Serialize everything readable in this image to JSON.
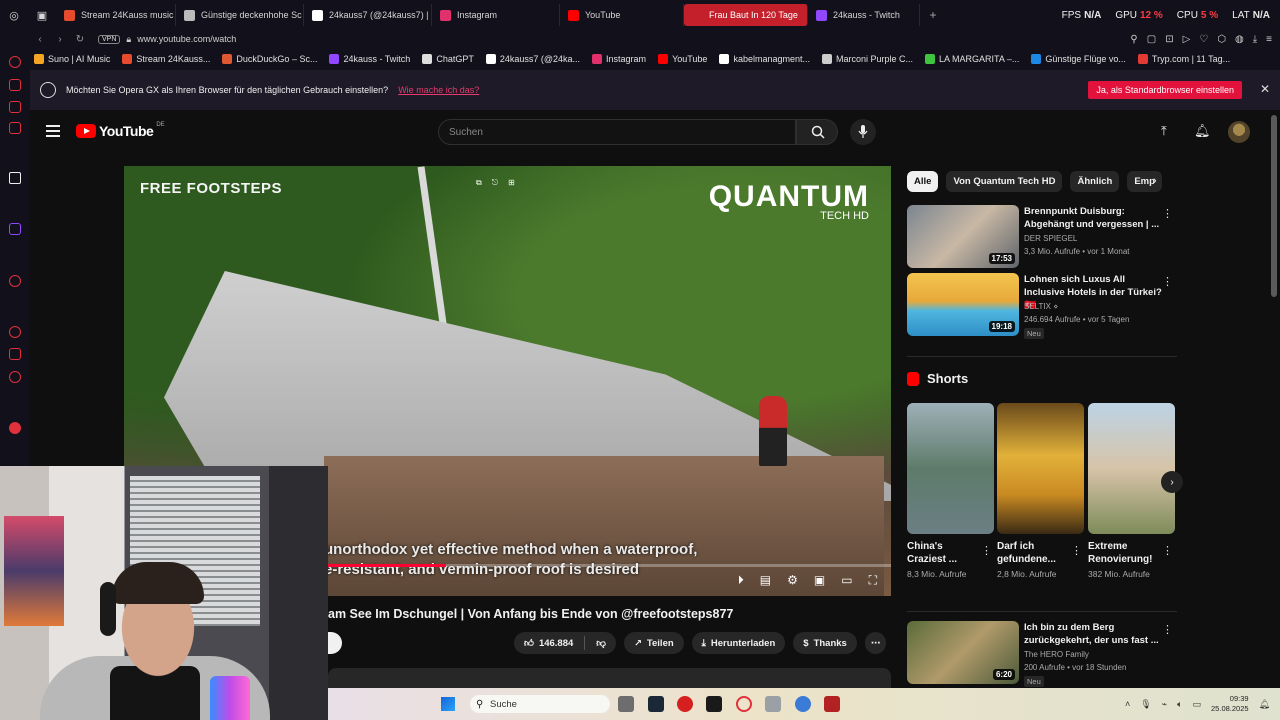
{
  "browser": {
    "tabs": [
      {
        "label": "Stream 24Kauss music | L",
        "color": "#e54b2c"
      },
      {
        "label": "Günstige deckenhohe Sc",
        "color": "#bbbbbb"
      },
      {
        "label": "24kauss7 (@24kauss7) |",
        "color": "#ffffff"
      },
      {
        "label": "Instagram",
        "color": "#e1306c"
      },
      {
        "label": "YouTube",
        "color": "#ff0000"
      },
      {
        "label": "Frau Baut In 120 Tage",
        "color": "#ffffff",
        "active": true
      },
      {
        "label": "24kauss - Twitch",
        "color": "#9146ff"
      }
    ],
    "sys": {
      "fps_label": "FPS",
      "fps_value": "N/A",
      "gpu_label": "GPU",
      "gpu_value": "12 %",
      "cpu_label": "CPU",
      "cpu_value": "5 %",
      "lat_label": "LAT",
      "lat_value": "N/A"
    },
    "vpn": "VPN",
    "url": "www.youtube.com/watch",
    "bookmarks": [
      {
        "label": "Suno | AI Music",
        "color": "#f5a524"
      },
      {
        "label": "Stream 24Kauss...",
        "color": "#e54b2c"
      },
      {
        "label": "DuckDuckGo – Sc...",
        "color": "#de5833"
      },
      {
        "label": "24kauss - Twitch",
        "color": "#9146ff"
      },
      {
        "label": "ChatGPT",
        "color": "#dddddd"
      },
      {
        "label": "24kauss7 (@24ka...",
        "color": "#ffffff"
      },
      {
        "label": "Instagram",
        "color": "#e1306c"
      },
      {
        "label": "YouTube",
        "color": "#ff0000"
      },
      {
        "label": "kabelmanagment...",
        "color": "#ffffff"
      },
      {
        "label": "Marconi Purple C...",
        "color": "#cccccc"
      },
      {
        "label": "LA MARGARITA –...",
        "color": "#3ec43e"
      },
      {
        "label": "Günstige Flüge vo...",
        "color": "#1e88e5"
      },
      {
        "label": "Tryp.com | 11 Tag...",
        "color": "#e53935"
      }
    ]
  },
  "infobar": {
    "text": "Möchten Sie Opera GX als Ihren Browser für den täglichen Gebrauch einstellen?",
    "link": "Wie mache ich das?",
    "button": "Ja, als Standardbrowser einstellen",
    "close": "✕"
  },
  "youtube": {
    "logo": "YouTube",
    "region": "DE",
    "search_placeholder": "Suchen",
    "player": {
      "watermark_left": "FREE FOOTSTEPS",
      "watermark_brand": "QUANTUM",
      "watermark_brand_sub": "TECH HD",
      "subtitle_line1": "unorthodox yet effective method when a waterproof,",
      "subtitle_line2": "e-resistant, and vermin-proof roof is desired",
      "progress": 0.42
    },
    "video_title": "am See Im Dschungel | Von Anfang bis Ende von @freefootsteps877",
    "actions": {
      "likes": "146.884",
      "share": "Teilen",
      "download": "Herunterladen",
      "thanks": "Thanks"
    },
    "chips": [
      "Alle",
      "Von Quantum Tech HD",
      "Ähnlich",
      "Emp"
    ],
    "recommendations": [
      {
        "title": "Brennpunkt Duisburg: Abgehängt und vergessen | ...",
        "channel": "DER SPIEGEL",
        "meta": "3,3 Mio. Aufrufe • vor 1 Monat",
        "duration": "17:53",
        "badge": ""
      },
      {
        "title": "Lohnen sich Luxus All Inclusive Hotels in der Türkei? 🇹🇷",
        "channel": "SELTIX ⋄",
        "meta": "246.694 Aufrufe • vor 5 Tagen",
        "duration": "19:18",
        "badge": "Neu"
      },
      {
        "title": "Ich bin zu dem Berg zurückgekehrt, der uns fast ...",
        "channel": "The HERO Family",
        "meta": "200 Aufrufe • vor 18 Stunden",
        "duration": "6:20",
        "badge": "Neu"
      }
    ],
    "shorts_label": "Shorts",
    "shorts": [
      {
        "title": "China's Craziest ...",
        "views": "8,3 Mio. Aufrufe"
      },
      {
        "title": "Darf ich gefundene...",
        "views": "2,8 Mio. Aufrufe"
      },
      {
        "title": "Extreme Renovierung!",
        "views": "382 Mio. Aufrufe"
      }
    ]
  },
  "taskbar": {
    "search": "Suche",
    "time": "09:39",
    "date": "25.08.2025"
  }
}
